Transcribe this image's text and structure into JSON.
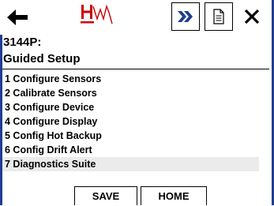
{
  "toolbar": {
    "back_icon": "back-arrow-icon",
    "logo_icon": "hw-logo-icon",
    "forward_icon": "double-chevron-right-icon",
    "document_icon": "document-icon",
    "close_icon": "close-icon",
    "forward_color": "#1f3d91",
    "logo_color": "#cc0000"
  },
  "header": {
    "device_tag": "3144P:",
    "title": "Guided Setup"
  },
  "menu": {
    "items": [
      {
        "label": "1 Configure Sensors"
      },
      {
        "label": "2 Calibrate Sensors"
      },
      {
        "label": "3 Configure Device"
      },
      {
        "label": "4 Configure Display"
      },
      {
        "label": "5 Config Hot Backup"
      },
      {
        "label": "6 Config Drift Alert"
      },
      {
        "label": "7 Diagnostics Suite",
        "selected": true
      }
    ]
  },
  "footer": {
    "save_label": "SAVE",
    "home_label": "HOME"
  },
  "colors": {
    "frame": "#1f3d91",
    "selected_row": "#ebebeb"
  }
}
